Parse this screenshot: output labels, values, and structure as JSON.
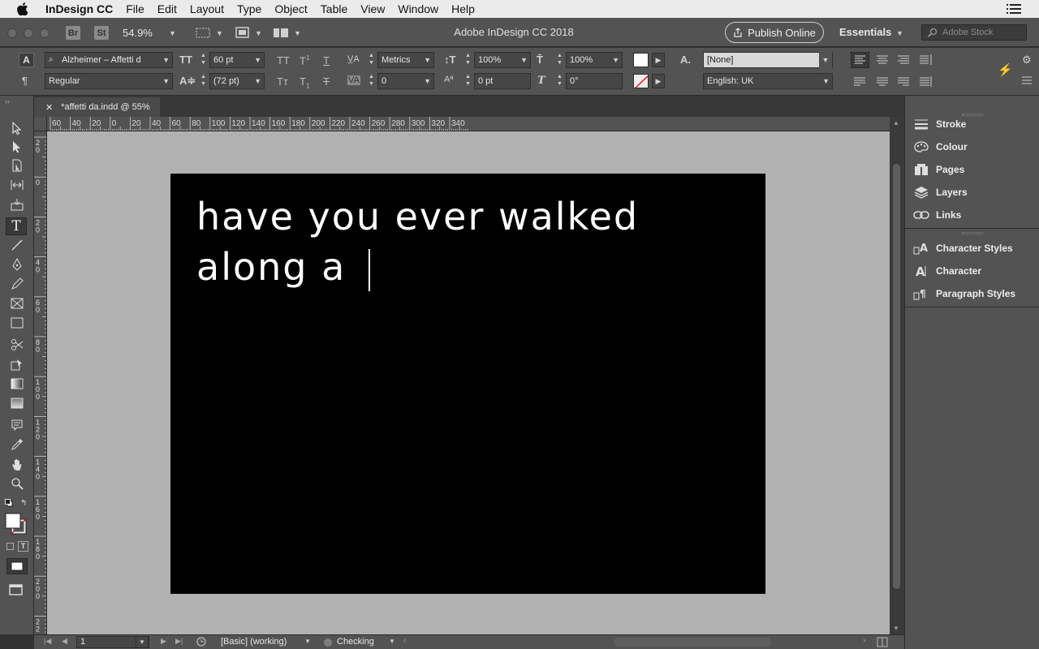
{
  "menubar": {
    "app_name": "InDesign CC",
    "menus": [
      "File",
      "Edit",
      "Layout",
      "Type",
      "Object",
      "Table",
      "View",
      "Window",
      "Help"
    ]
  },
  "appbar": {
    "bridge_badge": "Br",
    "stock_badge": "St",
    "zoom": "54.9%",
    "title": "Adobe InDesign CC 2018",
    "publish_label": "Publish Online",
    "workspace": "Essentials",
    "stock_search_placeholder": "Adobe Stock"
  },
  "control": {
    "font_family": "Alzheimer – Affetti d",
    "font_style": "Regular",
    "font_size": "60 pt",
    "leading": "(72 pt)",
    "kerning": "Metrics",
    "tracking": "0",
    "vertical_scale": "100%",
    "horizontal_scale": "100%",
    "baseline_shift": "0 pt",
    "skew": "0°",
    "char_style": "[None]",
    "language": "English: UK"
  },
  "document": {
    "tab_label": "*affetti da.indd @ 55%",
    "text_line1": "have you ever walked",
    "text_line2": "along a"
  },
  "rulers": {
    "h_labels": [
      "60",
      "40",
      "20",
      "0",
      "20",
      "40",
      "60",
      "80",
      "100",
      "120",
      "140",
      "160",
      "180",
      "200",
      "220",
      "240",
      "260",
      "280",
      "300",
      "320",
      "340"
    ],
    "v_labels": [
      "2\n0",
      "0",
      "2\n0",
      "4\n0",
      "6\n0",
      "8\n0",
      "1\n0\n0",
      "1\n2\n0",
      "1\n4\n0",
      "1\n6\n0",
      "1\n8\n0",
      "2\n0\n0",
      "2\n2"
    ]
  },
  "status": {
    "page_number": "1",
    "preflight_profile": "[Basic] (working)",
    "preflight_status": "Checking"
  },
  "panels": {
    "group1": [
      "Stroke",
      "Colour",
      "Pages",
      "Layers",
      "Links"
    ],
    "group2": [
      "Character Styles",
      "Character",
      "Paragraph Styles"
    ]
  },
  "colors": {
    "ui_bg": "#535353",
    "pasteboard": "#b1b1b1",
    "page": "#000000",
    "text": "#ffffff"
  }
}
